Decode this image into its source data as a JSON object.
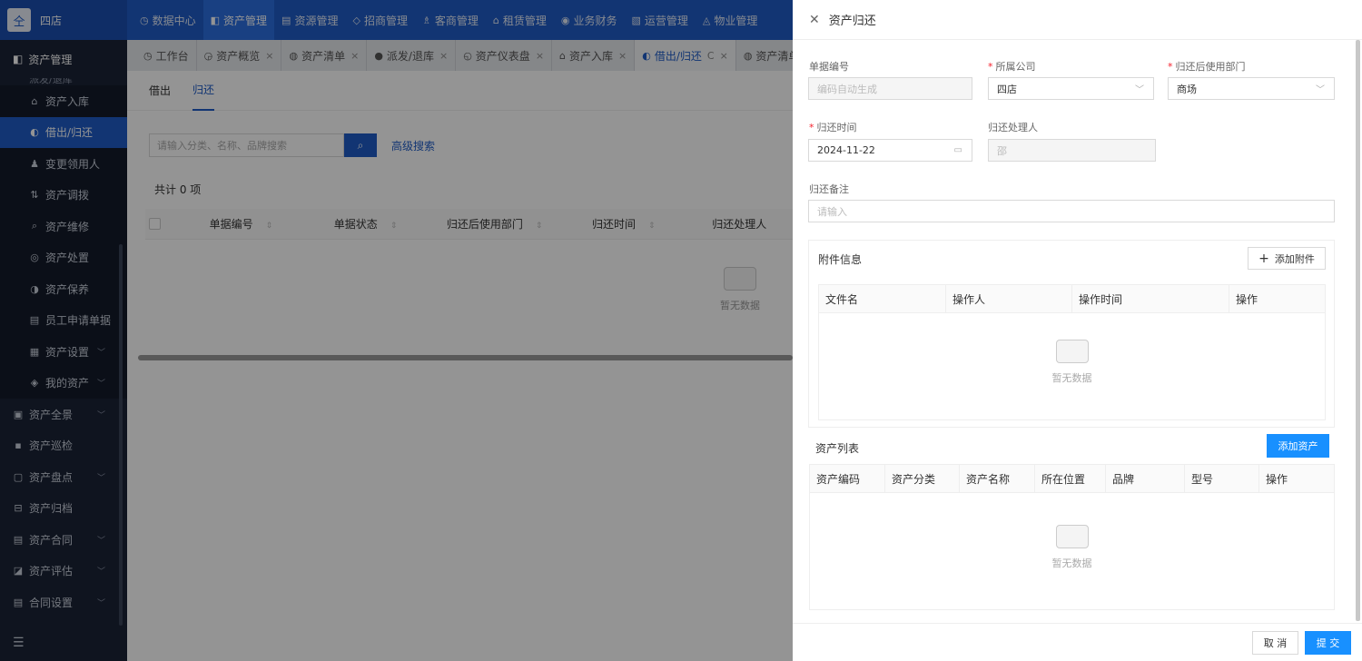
{
  "app": {
    "store_name": "四店",
    "logo_glyph": "仝"
  },
  "topnav": [
    {
      "label": "数据中心",
      "icon": "dashboard-icon",
      "glyph": "◷"
    },
    {
      "label": "资产管理",
      "icon": "box-icon",
      "glyph": "◧",
      "active": true
    },
    {
      "label": "资源管理",
      "icon": "document-icon",
      "glyph": "▤"
    },
    {
      "label": "招商管理",
      "icon": "tag-icon",
      "glyph": "◇"
    },
    {
      "label": "客商管理",
      "icon": "users-icon",
      "glyph": "♗"
    },
    {
      "label": "租赁管理",
      "icon": "home-icon",
      "glyph": "⌂"
    },
    {
      "label": "业务财务",
      "icon": "coin-icon",
      "glyph": "◉"
    },
    {
      "label": "运营管理",
      "icon": "chart-icon",
      "glyph": "▧"
    },
    {
      "label": "物业管理",
      "icon": "building-icon",
      "glyph": "◬"
    }
  ],
  "sidebar": {
    "header": "资产管理",
    "cut_item": "派发/退库",
    "items": [
      {
        "label": "资产入库",
        "glyph": "⌂"
      },
      {
        "label": "借出/归还",
        "glyph": "◐",
        "active": true
      },
      {
        "label": "变更领用人",
        "glyph": "♟"
      },
      {
        "label": "资产调拨",
        "glyph": "⇅"
      },
      {
        "label": "资产维修",
        "glyph": "⌕"
      },
      {
        "label": "资产处置",
        "glyph": "◎"
      },
      {
        "label": "资产保养",
        "glyph": "◑"
      },
      {
        "label": "员工申请单据",
        "glyph": "▤"
      },
      {
        "label": "资产设置",
        "glyph": "▦",
        "chevron": "﹀"
      },
      {
        "label": "我的资产",
        "glyph": "◈",
        "chevron": "﹀"
      }
    ],
    "top_items": [
      {
        "label": "资产全景",
        "glyph": "▣",
        "chevron": "﹀"
      },
      {
        "label": "资产巡检",
        "glyph": "▪"
      },
      {
        "label": "资产盘点",
        "glyph": "▢",
        "chevron": "﹀"
      },
      {
        "label": "资产归档",
        "glyph": "⊟"
      },
      {
        "label": "资产合同",
        "glyph": "▤",
        "chevron": "﹀"
      },
      {
        "label": "资产评估",
        "glyph": "◪",
        "chevron": "﹀"
      },
      {
        "label": "合同设置",
        "glyph": "▤",
        "chevron": "﹀"
      }
    ],
    "footer_glyph": "☰"
  },
  "tabs": [
    {
      "label": "工作台",
      "glyph": "◷"
    },
    {
      "label": "资产概览",
      "glyph": "◶",
      "close": "×"
    },
    {
      "label": "资产清单",
      "glyph": "◍",
      "close": "×"
    },
    {
      "label": "派发/退库",
      "glyph": "●",
      "close": "×"
    },
    {
      "label": "资产仪表盘",
      "glyph": "◵",
      "close": "×"
    },
    {
      "label": "资产入库",
      "glyph": "⌂",
      "close": "×"
    },
    {
      "label": "借出/归还",
      "glyph": "◐",
      "close": "×",
      "refresh": "C",
      "active": true
    },
    {
      "label": "资产清单",
      "glyph": "◍"
    }
  ],
  "main": {
    "subtabs": [
      "借出",
      "归还"
    ],
    "active_subtab": "归还",
    "search_placeholder": "请输入分类、名称、品牌搜索",
    "search_glyph": "⌕",
    "advanced_search": "高级搜索",
    "total": "共计 0 项",
    "columns": [
      "单据编号",
      "单据状态",
      "归还后使用部门",
      "归还时间",
      "归还处理人"
    ],
    "sort_glyph": "⇕",
    "empty": "暂无数据"
  },
  "drawer": {
    "title": "资产归还",
    "close_glyph": "✕",
    "fields": {
      "doc_no": {
        "label": "单据编号",
        "placeholder": "编码自动生成"
      },
      "company": {
        "label": "所属公司",
        "value": "四店",
        "required": true
      },
      "department": {
        "label": "归还后使用部门",
        "value": "商场",
        "required": true
      },
      "return_time": {
        "label": "归还时间",
        "value": "2024-11-22",
        "required": true
      },
      "handler": {
        "label": "归还处理人",
        "value": "邵"
      },
      "remark": {
        "label": "归还备注",
        "placeholder": "请输入"
      }
    },
    "required_mark": "*",
    "select_glyph": "﹀",
    "calendar_glyph": "▭",
    "attachments": {
      "title": "附件信息",
      "add_button": "添加附件",
      "plus_glyph": "+",
      "columns": [
        "文件名",
        "操作人",
        "操作时间",
        "操作"
      ],
      "empty": "暂无数据"
    },
    "assets": {
      "title": "资产列表",
      "add_button": "添加资产",
      "columns": [
        "资产编码",
        "资产分类",
        "资产名称",
        "所在位置",
        "品牌",
        "型号",
        "操作"
      ],
      "empty": "暂无数据"
    },
    "cancel": "取 消",
    "submit": "提 交"
  },
  "colors": {
    "primary": "#1f5cc7",
    "button_blue": "#1890ff",
    "sidebar_bg": "#1b2436",
    "required": "#f5222d"
  }
}
